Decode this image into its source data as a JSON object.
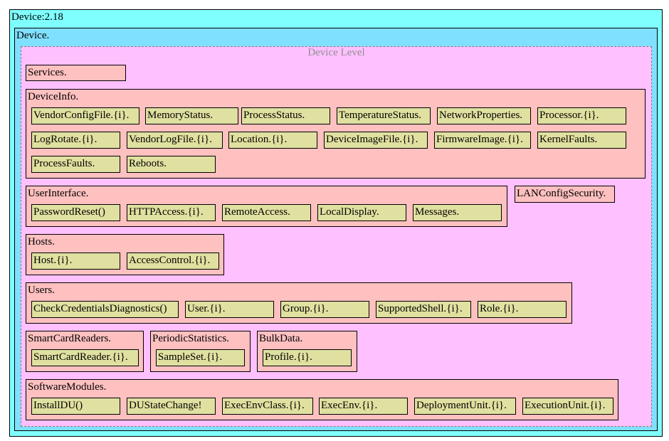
{
  "root": {
    "label": "Device:2.18"
  },
  "device": {
    "label": "Device."
  },
  "level": {
    "title": "Device Level"
  },
  "objects": {
    "services": {
      "label": "Services."
    },
    "deviceinfo": {
      "label": "DeviceInfo.",
      "items": [
        "VendorConfigFile.{i}.",
        "MemoryStatus.",
        "ProcessStatus.",
        "TemperatureStatus.",
        "NetworkProperties.",
        "Processor.{i}.",
        "LogRotate.{i}.",
        "VendorLogFile.{i}.",
        "Location.{i}.",
        "DeviceImageFile.{i}.",
        "FirmwareImage.{i}.",
        "KernelFaults.",
        "ProcessFaults.",
        "Reboots."
      ]
    },
    "userinterface": {
      "label": "UserInterface.",
      "items": [
        "PasswordReset()",
        "HTTPAccess.{i}.",
        "RemoteAccess.",
        "LocalDisplay.",
        "Messages."
      ]
    },
    "lanconfigsecurity": {
      "label": "LANConfigSecurity."
    },
    "hosts": {
      "label": "Hosts.",
      "items": [
        "Host.{i}.",
        "AccessControl.{i}."
      ]
    },
    "users": {
      "label": "Users.",
      "items": [
        "CheckCredentialsDiagnostics()",
        "User.{i}.",
        "Group.{i}.",
        "SupportedShell.{i}.",
        "Role.{i}."
      ]
    },
    "smartcardreaders": {
      "label": "SmartCardReaders.",
      "items": [
        "SmartCardReader.{i}."
      ]
    },
    "periodicstatistics": {
      "label": "PeriodicStatistics.",
      "items": [
        "SampleSet.{i}."
      ]
    },
    "bulkdata": {
      "label": "BulkData.",
      "items": [
        "Profile.{i}."
      ]
    },
    "softwaremodules": {
      "label": "SoftwareModules.",
      "items": [
        "InstallDU()",
        "DUStateChange!",
        "ExecEnvClass.{i}.",
        "ExecEnv.{i}.",
        "DeploymentUnit.{i}.",
        "ExecutionUnit.{i}."
      ]
    }
  }
}
